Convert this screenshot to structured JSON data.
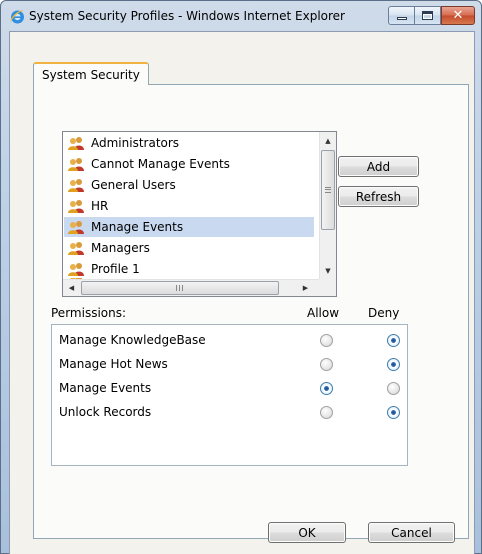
{
  "window": {
    "title": "System Security Profiles - Windows Internet Explorer",
    "icon": "internet-explorer-icon",
    "close_glyph": "✕"
  },
  "tabs": [
    {
      "label": "System Security",
      "active": true
    }
  ],
  "profiles": {
    "items": [
      {
        "label": "Administrators",
        "icon": "users-icon",
        "selected": false
      },
      {
        "label": "Cannot Manage Events",
        "icon": "users-icon",
        "selected": false
      },
      {
        "label": "General Users",
        "icon": "users-icon",
        "selected": false
      },
      {
        "label": "HR",
        "icon": "users-icon",
        "selected": false
      },
      {
        "label": "Manage Events",
        "icon": "users-icon",
        "selected": true
      },
      {
        "label": "Managers",
        "icon": "users-icon",
        "selected": false
      },
      {
        "label": "Profile 1",
        "icon": "users-icon",
        "selected": false
      }
    ],
    "selected_color": "#c9d9f0"
  },
  "buttons": {
    "add": "Add",
    "refresh": "Refresh",
    "ok": "OK",
    "cancel": "Cancel"
  },
  "permissions": {
    "label": "Permissions:",
    "allow_header": "Allow",
    "deny_header": "Deny",
    "rows": [
      {
        "name": "Manage KnowledgeBase",
        "value": "deny"
      },
      {
        "name": "Manage Hot News",
        "value": "deny"
      },
      {
        "name": "Manage Events",
        "value": "allow"
      },
      {
        "name": "Unlock Records",
        "value": "deny"
      }
    ]
  },
  "colors": {
    "tab_accent": "#f0b341",
    "radio_checked": "#2a6bb3"
  }
}
